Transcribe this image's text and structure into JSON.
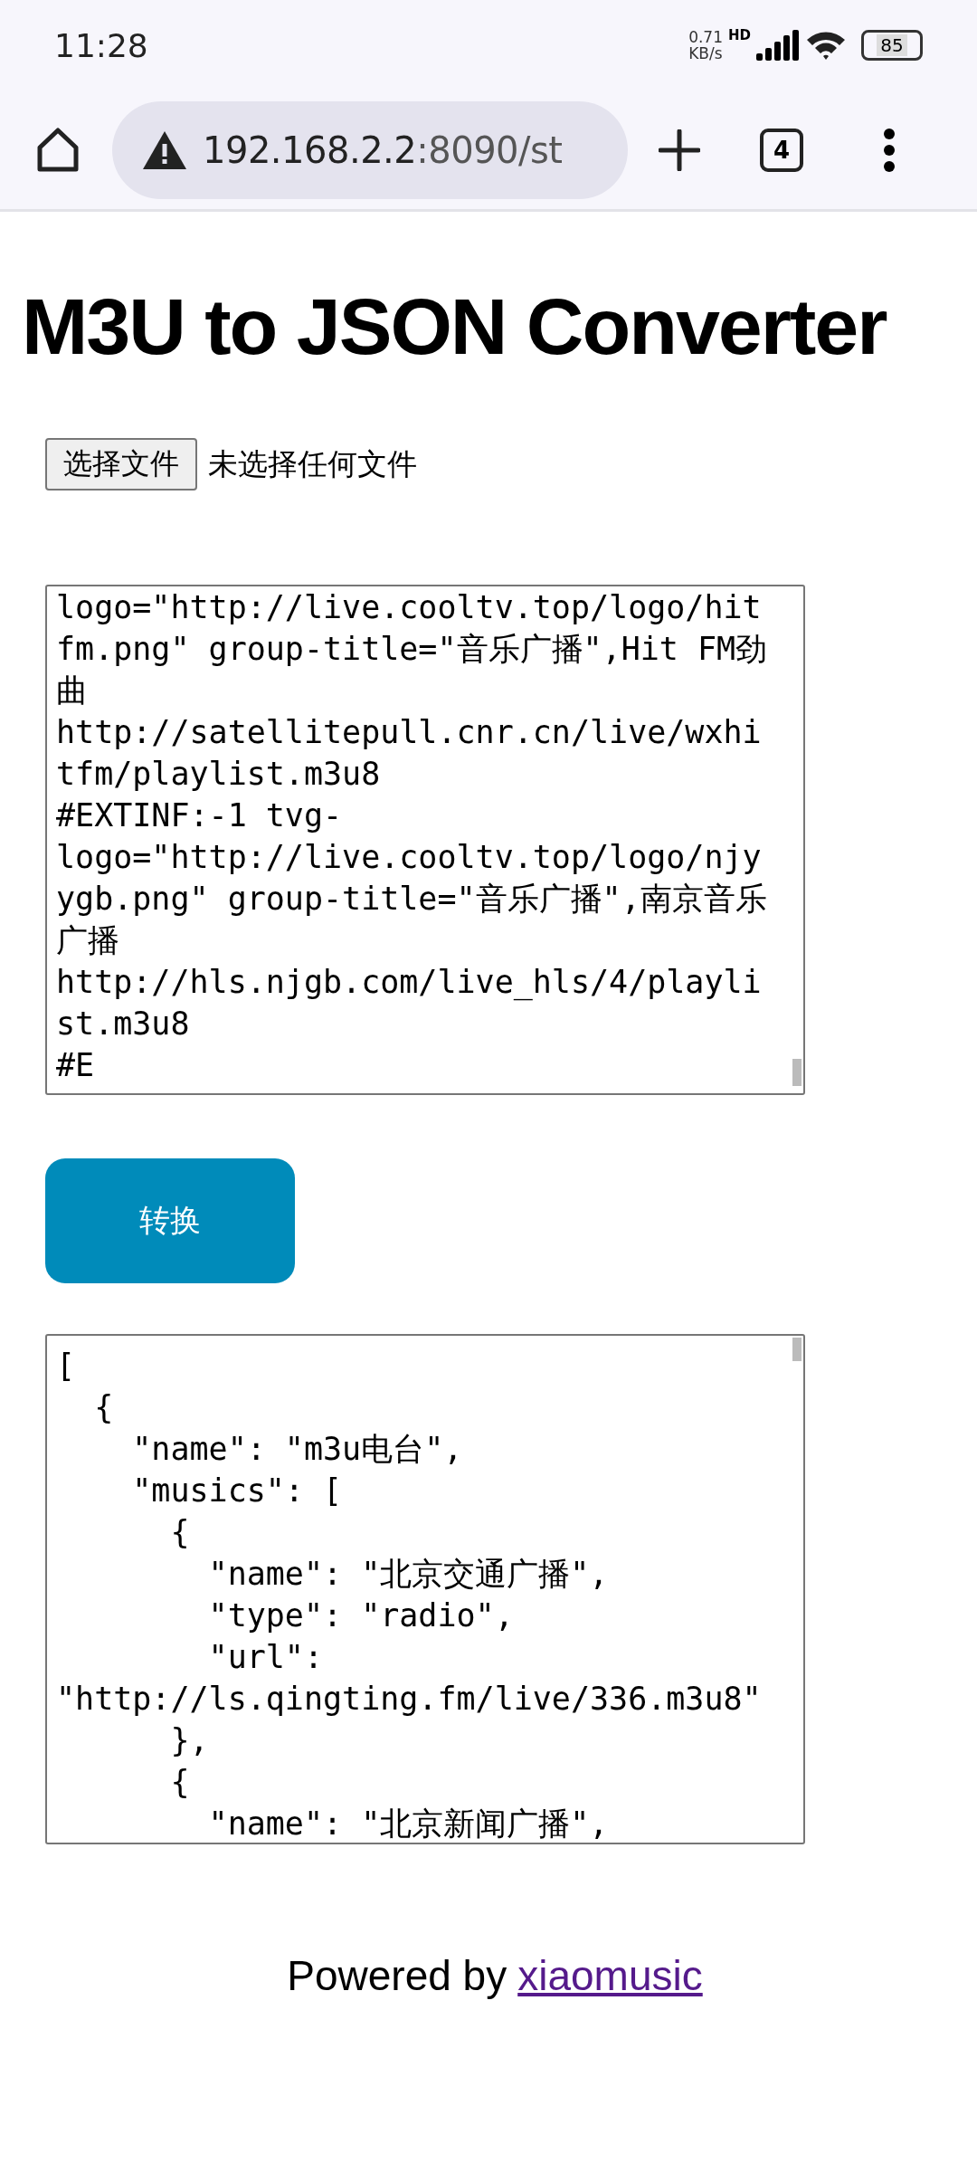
{
  "status_bar": {
    "time": "11:28",
    "net_speed": "0.71",
    "net_unit": "KB/s",
    "network_type": "HD",
    "battery": "85"
  },
  "browser": {
    "url_host": "192.168.2.2",
    "url_rest": ":8090/st",
    "tab_count": "4"
  },
  "title": "M3U to JSON Converter",
  "file_picker": {
    "button": "选择文件",
    "status": "未选择任何文件"
  },
  "input_lines": [
    "logo=\"http://live.cooltv.top/logo/hit",
    "fm.png\" group-title=\"音乐广播\",Hit FM劲",
    "曲",
    "http://satellitepull.cnr.cn/live/wxhi",
    "tfm/playlist.m3u8",
    "#EXTINF:-1 tvg-",
    "logo=\"http://live.cooltv.top/logo/njy",
    "ygb.png\" group-title=\"音乐广播\",南京音乐",
    "广播",
    "http://hls.njgb.com/live_hls/4/playli",
    "st.m3u8",
    "#E"
  ],
  "convert_button": "转换",
  "output_lines": [
    "[",
    "  {",
    "    \"name\": \"m3u电台\",",
    "    \"musics\": [",
    "      {",
    "        \"name\": \"北京交通广播\",",
    "        \"type\": \"radio\",",
    "        \"url\":",
    "\"http://ls.qingting.fm/live/336.m3u8\"",
    "      },",
    "      {",
    "        \"name\": \"北京新闻广播\","
  ],
  "footer": {
    "text": "Powered by",
    "link": "xiaomusic"
  }
}
